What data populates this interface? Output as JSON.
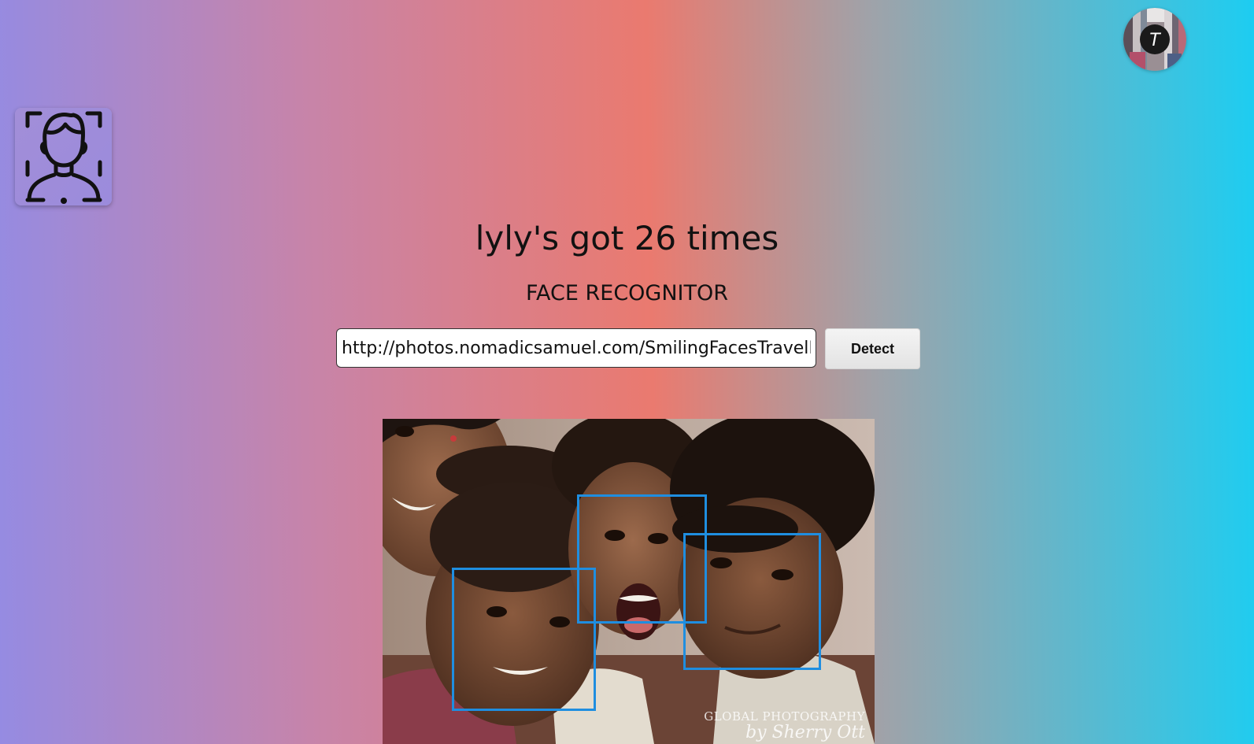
{
  "header": {
    "title": "lyly's got 26 times",
    "subtitle": "FACE RECOGNITOR"
  },
  "logo": {
    "icon": "face-scan-icon"
  },
  "profile": {
    "avatar_icon": "user-avatar-icon",
    "initial": "T"
  },
  "search": {
    "value": "http://photos.nomadicsamuel.com/SmilingFacesTravelPhotography.jpg",
    "button_label": "Detect"
  },
  "result": {
    "image_icon": "result-photo",
    "detected_faces_count": 3,
    "watermark_line1": "GLOBAL PHOTOGRAPHY",
    "watermark_line2": "by Sherry Ott"
  },
  "colors": {
    "gradient_left": "#958be2",
    "gradient_mid": "#ea7a6f",
    "gradient_right": "#1dcdf1",
    "face_box": "#1f8ee0"
  }
}
